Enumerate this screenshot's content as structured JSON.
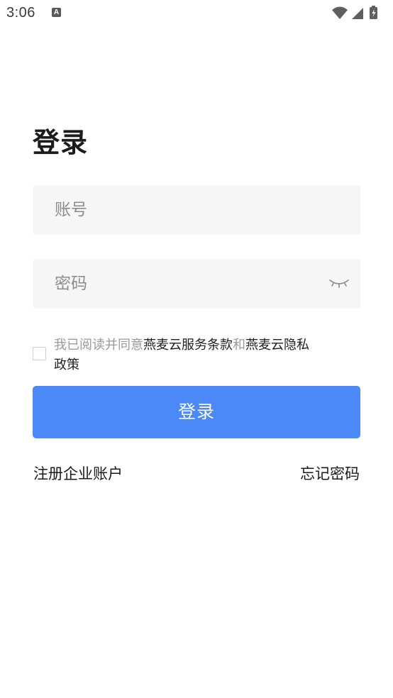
{
  "status_bar": {
    "time": "3:06",
    "notification_icon": "A",
    "icons": [
      "wifi-icon",
      "signal-icon",
      "battery-charging-icon"
    ]
  },
  "login": {
    "title": "登录",
    "account_placeholder": "账号",
    "password_placeholder": "密码",
    "password_toggle_icon": "eye-closed-icon",
    "agreement": {
      "prefix": "我已阅读并同意",
      "terms_link": "燕麦云服务条款",
      "connector": "和",
      "privacy_link_line1": "燕麦云隐私",
      "privacy_link_line2": "政策"
    },
    "submit_label": "登录",
    "register_label": "注册企业账户",
    "forgot_label": "忘记密码"
  },
  "colors": {
    "accent": "#4a89f7",
    "input_background": "#f6f6f6",
    "placeholder": "#8c8c8c",
    "muted_text": "#9a9a9a"
  }
}
